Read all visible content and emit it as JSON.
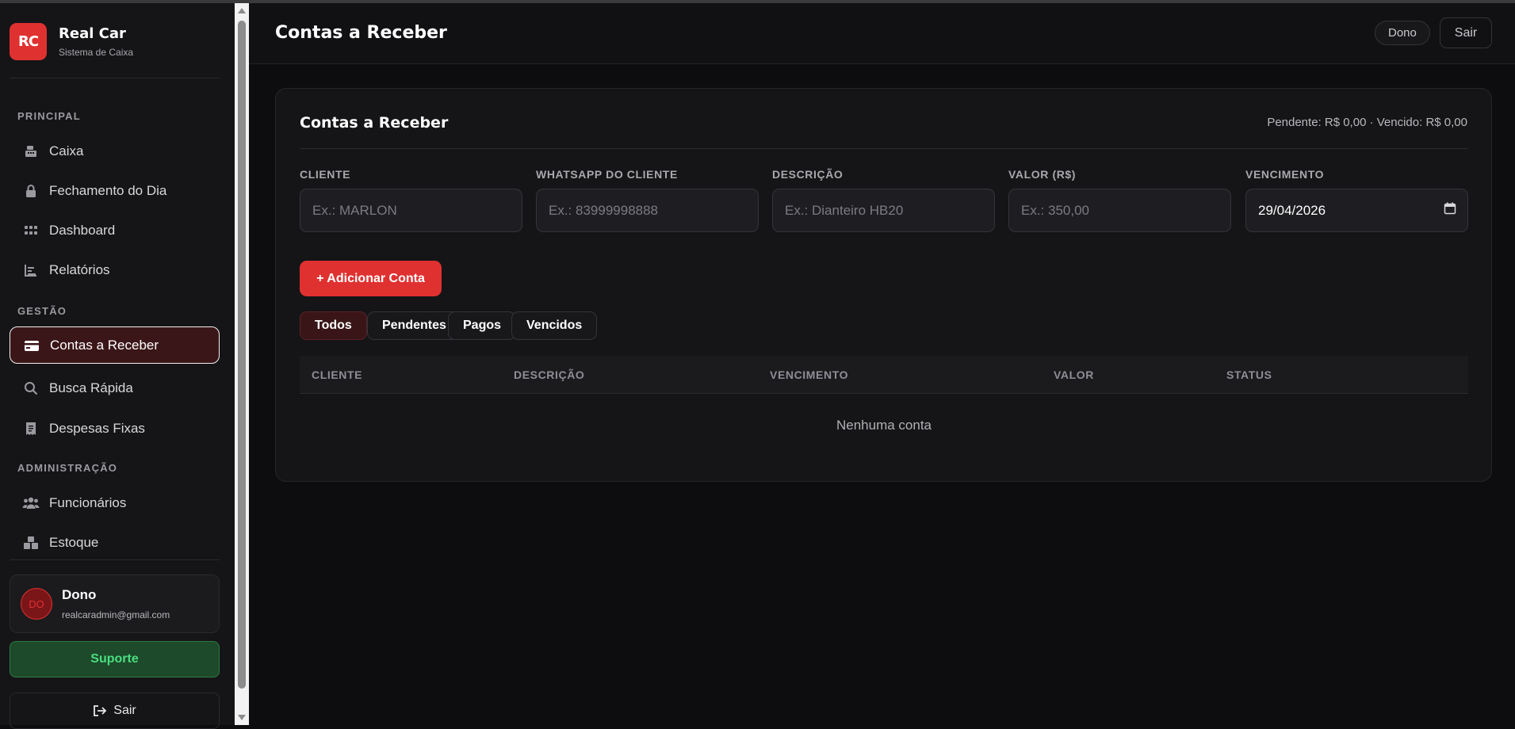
{
  "brand": {
    "logo": "RC",
    "name": "Real Car",
    "subtitle": "Sistema de Caixa"
  },
  "sidebar": {
    "sections": [
      {
        "label": "PRINCIPAL",
        "items": [
          {
            "label": "Caixa",
            "icon": "cash-register-icon"
          },
          {
            "label": "Fechamento do Dia",
            "icon": "lock-icon"
          },
          {
            "label": "Dashboard",
            "icon": "grid-icon"
          },
          {
            "label": "Relatórios",
            "icon": "chart-icon"
          }
        ]
      },
      {
        "label": "GESTÃO",
        "items": [
          {
            "label": "Contas a Receber",
            "icon": "credit-card-icon",
            "active": true
          },
          {
            "label": "Busca Rápida",
            "icon": "search-icon"
          },
          {
            "label": "Despesas Fixas",
            "icon": "receipt-icon"
          }
        ]
      },
      {
        "label": "ADMINISTRAÇÃO",
        "items": [
          {
            "label": "Funcionários",
            "icon": "users-icon"
          },
          {
            "label": "Estoque",
            "icon": "boxes-icon"
          }
        ]
      }
    ],
    "user": {
      "initials": "DO",
      "name": "Dono",
      "email": "realcaradmin@gmail.com"
    },
    "support_label": "Suporte",
    "logout_label": "Sair"
  },
  "header": {
    "title": "Contas a Receber",
    "role": "Dono",
    "logout_label": "Sair"
  },
  "card": {
    "title": "Contas a Receber",
    "summary": "Pendente: R$ 0,00 · Vencido: R$ 0,00",
    "fields": {
      "cliente": {
        "label": "CLIENTE",
        "placeholder": "Ex.: MARLON"
      },
      "whatsapp": {
        "label": "WHATSAPP DO CLIENTE",
        "placeholder": "Ex.: 83999998888"
      },
      "descricao": {
        "label": "DESCRIÇÃO",
        "placeholder": "Ex.: Dianteiro HB20"
      },
      "valor": {
        "label": "VALOR (R$)",
        "placeholder": "Ex.: 350,00"
      },
      "vencimento": {
        "label": "VENCIMENTO",
        "value": "29/04/2026"
      }
    },
    "add_button": "+ Adicionar Conta",
    "filters": [
      "Todos",
      "Pendentes",
      "Pagos",
      "Vencidos"
    ],
    "active_filter": "Todos",
    "table": {
      "columns": [
        "CLIENTE",
        "DESCRIÇÃO",
        "VENCIMENTO",
        "VALOR",
        "STATUS"
      ],
      "empty_text": "Nenhuma conta"
    }
  },
  "colors": {
    "accent": "#e03131",
    "support": "#4ade80",
    "background": "#0d0d0f"
  }
}
